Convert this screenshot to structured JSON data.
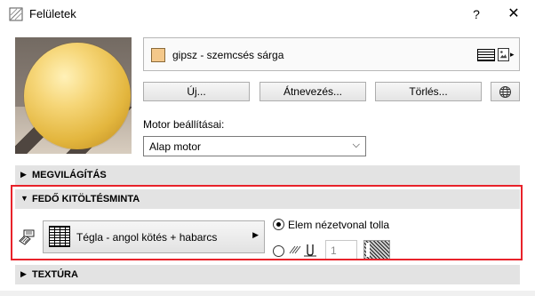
{
  "window": {
    "title": "Felületek",
    "help_label": "?",
    "close_label": "✕"
  },
  "material": {
    "name": "gipsz - szemcsés sárga",
    "swatch_color": "#f4c88a"
  },
  "buttons": {
    "new_label": "Új...",
    "rename_label": "Átnevezés...",
    "delete_label": "Törlés..."
  },
  "engine": {
    "label": "Motor beállításai:",
    "selected": "Alap motor"
  },
  "sections": {
    "lighting": "MEGVILÁGÍTÁS",
    "fill": "FEDŐ KITÖLTÉSMINTA",
    "texture": "TEXTÚRA"
  },
  "fill": {
    "pattern_name": "Tégla - angol kötés + habarcs",
    "option_view_pen": "Elem nézetvonal tolla",
    "pen_value": "1",
    "selected_option": "view-pen"
  },
  "colors": {
    "highlight": "#e8222a",
    "section_bg": "#e3e3e3"
  }
}
